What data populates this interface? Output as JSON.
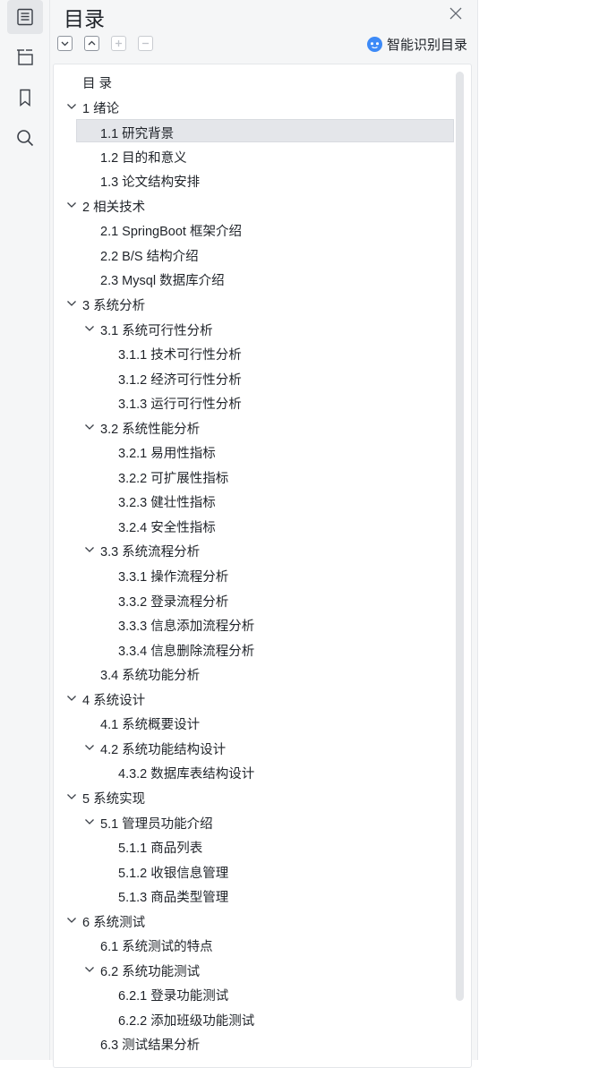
{
  "sidebar": {
    "icons": [
      "outline-icon",
      "structure-icon",
      "bookmark-icon",
      "search-icon"
    ]
  },
  "panel": {
    "title": "目录",
    "ai_button": "智能识别目录",
    "tools": [
      "collapse-all",
      "expand-all",
      "add-entry",
      "remove-entry"
    ]
  },
  "toc": {
    "items": [
      {
        "text": "目  录",
        "level": 0,
        "toggle": false,
        "expanded": false,
        "selected": false
      },
      {
        "text": "1  绪论",
        "level": 0,
        "toggle": true,
        "expanded": true,
        "selected": false
      },
      {
        "text": "1.1  研究背景",
        "level": 1,
        "toggle": false,
        "expanded": false,
        "selected": true
      },
      {
        "text": "1.2  目的和意义",
        "level": 1,
        "toggle": false,
        "expanded": false,
        "selected": false
      },
      {
        "text": "1.3  论文结构安排",
        "level": 1,
        "toggle": false,
        "expanded": false,
        "selected": false
      },
      {
        "text": "2  相关技术",
        "level": 0,
        "toggle": true,
        "expanded": true,
        "selected": false
      },
      {
        "text": "2.1 SpringBoot 框架介绍",
        "level": 1,
        "toggle": false,
        "expanded": false,
        "selected": false
      },
      {
        "text": "2.2 B/S 结构介绍",
        "level": 1,
        "toggle": false,
        "expanded": false,
        "selected": false
      },
      {
        "text": "2.3 Mysql 数据库介绍",
        "level": 1,
        "toggle": false,
        "expanded": false,
        "selected": false
      },
      {
        "text": "3  系统分析",
        "level": 0,
        "toggle": true,
        "expanded": true,
        "selected": false
      },
      {
        "text": "3.1  系统可行性分析",
        "level": 1,
        "toggle": true,
        "expanded": true,
        "selected": false
      },
      {
        "text": "3.1.1  技术可行性分析",
        "level": 2,
        "toggle": false,
        "expanded": false,
        "selected": false
      },
      {
        "text": "3.1.2  经济可行性分析",
        "level": 2,
        "toggle": false,
        "expanded": false,
        "selected": false
      },
      {
        "text": "3.1.3  运行可行性分析",
        "level": 2,
        "toggle": false,
        "expanded": false,
        "selected": false
      },
      {
        "text": "3.2  系统性能分析",
        "level": 1,
        "toggle": true,
        "expanded": true,
        "selected": false
      },
      {
        "text": "3.2.1  易用性指标",
        "level": 2,
        "toggle": false,
        "expanded": false,
        "selected": false
      },
      {
        "text": "3.2.2  可扩展性指标",
        "level": 2,
        "toggle": false,
        "expanded": false,
        "selected": false
      },
      {
        "text": "3.2.3  健壮性指标",
        "level": 2,
        "toggle": false,
        "expanded": false,
        "selected": false
      },
      {
        "text": "3.2.4  安全性指标",
        "level": 2,
        "toggle": false,
        "expanded": false,
        "selected": false
      },
      {
        "text": "3.3  系统流程分析",
        "level": 1,
        "toggle": true,
        "expanded": true,
        "selected": false
      },
      {
        "text": "3.3.1  操作流程分析",
        "level": 2,
        "toggle": false,
        "expanded": false,
        "selected": false
      },
      {
        "text": "3.3.2  登录流程分析",
        "level": 2,
        "toggle": false,
        "expanded": false,
        "selected": false
      },
      {
        "text": "3.3.3  信息添加流程分析",
        "level": 2,
        "toggle": false,
        "expanded": false,
        "selected": false
      },
      {
        "text": "3.3.4  信息删除流程分析",
        "level": 2,
        "toggle": false,
        "expanded": false,
        "selected": false
      },
      {
        "text": "3.4  系统功能分析",
        "level": 1,
        "toggle": false,
        "expanded": false,
        "selected": false
      },
      {
        "text": "4  系统设计",
        "level": 0,
        "toggle": true,
        "expanded": true,
        "selected": false
      },
      {
        "text": "4.1  系统概要设计",
        "level": 1,
        "toggle": false,
        "expanded": false,
        "selected": false
      },
      {
        "text": "4.2  系统功能结构设计",
        "level": 1,
        "toggle": true,
        "expanded": true,
        "selected": false
      },
      {
        "text": "4.3.2  数据库表结构设计",
        "level": 2,
        "toggle": false,
        "expanded": false,
        "selected": false
      },
      {
        "text": "5  系统实现",
        "level": 0,
        "toggle": true,
        "expanded": true,
        "selected": false
      },
      {
        "text": "5.1  管理员功能介绍",
        "level": 1,
        "toggle": true,
        "expanded": true,
        "selected": false
      },
      {
        "text": "5.1.1  商品列表",
        "level": 2,
        "toggle": false,
        "expanded": false,
        "selected": false
      },
      {
        "text": "5.1.2  收银信息管理",
        "level": 2,
        "toggle": false,
        "expanded": false,
        "selected": false
      },
      {
        "text": "5.1.3 商品类型管理",
        "level": 2,
        "toggle": false,
        "expanded": false,
        "selected": false
      },
      {
        "text": "6  系统测试",
        "level": 0,
        "toggle": true,
        "expanded": true,
        "selected": false
      },
      {
        "text": "6.1  系统测试的特点",
        "level": 1,
        "toggle": false,
        "expanded": false,
        "selected": false
      },
      {
        "text": "6.2  系统功能测试",
        "level": 1,
        "toggle": true,
        "expanded": true,
        "selected": false
      },
      {
        "text": "6.2.1  登录功能测试",
        "level": 2,
        "toggle": false,
        "expanded": false,
        "selected": false
      },
      {
        "text": "6.2.2  添加班级功能测试",
        "level": 2,
        "toggle": false,
        "expanded": false,
        "selected": false
      },
      {
        "text": "6.3  测试结果分析",
        "level": 1,
        "toggle": false,
        "expanded": false,
        "selected": false
      }
    ]
  },
  "colors": {
    "panel_bg": "#f5f6f7",
    "selected_bg": "#e4e6ea",
    "text": "#1f2329",
    "ai_accent": "#3d8af7"
  }
}
